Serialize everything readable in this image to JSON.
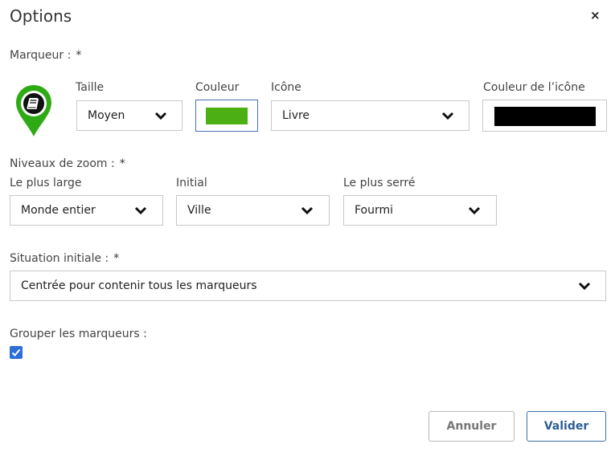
{
  "dialog": {
    "title": "Options",
    "close_label": "×"
  },
  "marker": {
    "label": "Marqueur :",
    "required": "*",
    "icon": "book-icon",
    "fill_color": "#2eab14",
    "size": {
      "label": "Taille",
      "value": "Moyen"
    },
    "color": {
      "label": "Couleur",
      "value": "#4caf13"
    },
    "icon_select": {
      "label": "Icône",
      "value": "Livre"
    },
    "icon_color": {
      "label": "Couleur de l’icône",
      "value": "#000000"
    }
  },
  "zoom": {
    "label": "Niveaux de zoom :",
    "required": "*",
    "widest": {
      "label": "Le plus large",
      "value": "Monde entier"
    },
    "initial": {
      "label": "Initial",
      "value": "Ville"
    },
    "tightest": {
      "label": "Le plus serré",
      "value": "Fourmi"
    }
  },
  "initial_position": {
    "label": "Situation initiale :",
    "required": "*",
    "value": "Centrée pour contenir tous les marqueurs"
  },
  "grouping": {
    "label": "Grouper les marqueurs :",
    "checked": true
  },
  "buttons": {
    "cancel": "Annuler",
    "validate": "Valider"
  },
  "colors": {
    "primary": "#2e5f94",
    "checkbox": "#2c6fd6",
    "focus_border": "#4a6fb0"
  }
}
